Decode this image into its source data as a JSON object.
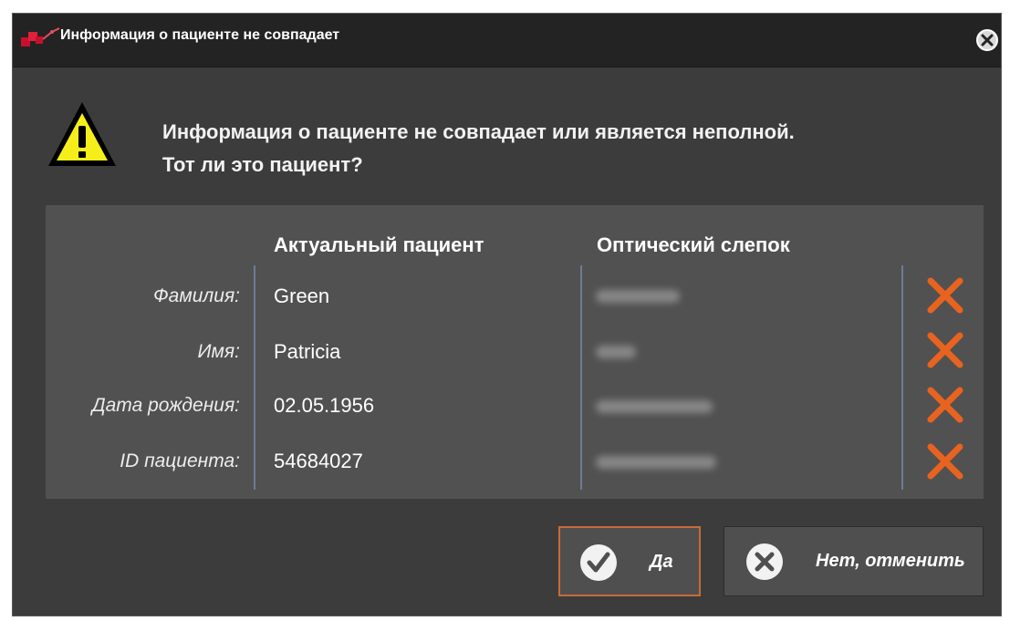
{
  "window": {
    "title": "Информация о пациенте не совпадает"
  },
  "message": {
    "line1": "Информация о пациенте не совпадает или является неполной.",
    "line2": "Тот ли это пациент?"
  },
  "table": {
    "headers": {
      "current": "Актуальный пациент",
      "optical": "Оптический слепок"
    },
    "rows": [
      {
        "label": "Фамилия:",
        "value": "Green",
        "status": "mismatch"
      },
      {
        "label": "Имя:",
        "value": "Patricia",
        "status": "mismatch"
      },
      {
        "label": "Дата рождения:",
        "value": "02.05.1956",
        "status": "mismatch"
      },
      {
        "label": "ID пациента:",
        "value": "54684027",
        "status": "mismatch"
      }
    ]
  },
  "buttons": {
    "yes": "Да",
    "no": "Нет, отменить"
  },
  "colors": {
    "accent": "#e8631f",
    "warning_fill": "#f5ee1a",
    "dialog_bg": "#3c3c3c",
    "table_bg": "#515151"
  },
  "icons": {
    "title": "app-logo-icon",
    "close": "close-icon",
    "warning": "warning-icon",
    "mismatch": "x-mark-icon",
    "yes": "checkmark-icon",
    "no": "cancel-icon"
  }
}
